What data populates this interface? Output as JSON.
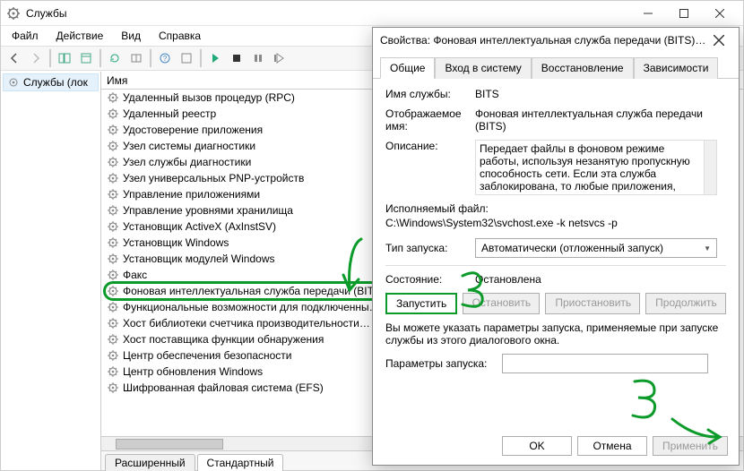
{
  "window": {
    "title": "Службы",
    "menubar": [
      "Файл",
      "Действие",
      "Вид",
      "Справка"
    ]
  },
  "leftPane": {
    "node": "Службы (лок"
  },
  "list": {
    "header": "Имя",
    "items": [
      "Удаленный вызов процедур (RPC)",
      "Удаленный реестр",
      "Удостоверение приложения",
      "Узел системы диагностики",
      "Узел службы диагностики",
      "Узел универсальных PNP-устройств",
      "Управление приложениями",
      "Управление уровнями хранилища",
      "Установщик ActiveX (AxInstSV)",
      "Установщик Windows",
      "Установщик модулей Windows",
      "Факс",
      "Фоновая интеллектуальная служба передачи (BITS)",
      "Функциональные возможности для подключенны…",
      "Хост библиотеки счетчика производительности…",
      "Хост поставщика функции обнаружения",
      "Центр обеспечения безопасности",
      "Центр обновления Windows",
      "Шифрованная файловая система (EFS)"
    ],
    "highlightIndex": 12,
    "tabs": {
      "extended": "Расширенный",
      "standard": "Стандартный"
    }
  },
  "dialog": {
    "title": "Свойства: Фоновая интеллектуальная служба передачи (BITS) (...",
    "tabs": [
      "Общие",
      "Вход в систему",
      "Восстановление",
      "Зависимости"
    ],
    "labels": {
      "serviceName": "Имя службы:",
      "displayName": "Отображаемое имя:",
      "description": "Описание:",
      "exeFile": "Исполняемый файл:",
      "startupType": "Тип запуска:",
      "state": "Состояние:",
      "startParamsHint": "Вы можете указать параметры запуска, применяемые при запуске службы из этого диалогового окна.",
      "startParams": "Параметры запуска:"
    },
    "values": {
      "serviceName": "BITS",
      "displayName": "Фоновая интеллектуальная служба передачи (BITS)",
      "description": "Передает файлы в фоновом режиме работы, используя незанятую пропускную способность сети. Если эта служба заблокирована, то любые приложения, зависящие от BITS, такие",
      "exeFile": "C:\\Windows\\System32\\svchost.exe -k netsvcs -p",
      "startupType": "Автоматически (отложенный запуск)",
      "state": "Остановлена"
    },
    "buttons": {
      "start": "Запустить",
      "stop": "Остановить",
      "pause": "Приостановить",
      "resume": "Продолжить",
      "ok": "OK",
      "cancel": "Отмена",
      "apply": "Применить"
    }
  }
}
